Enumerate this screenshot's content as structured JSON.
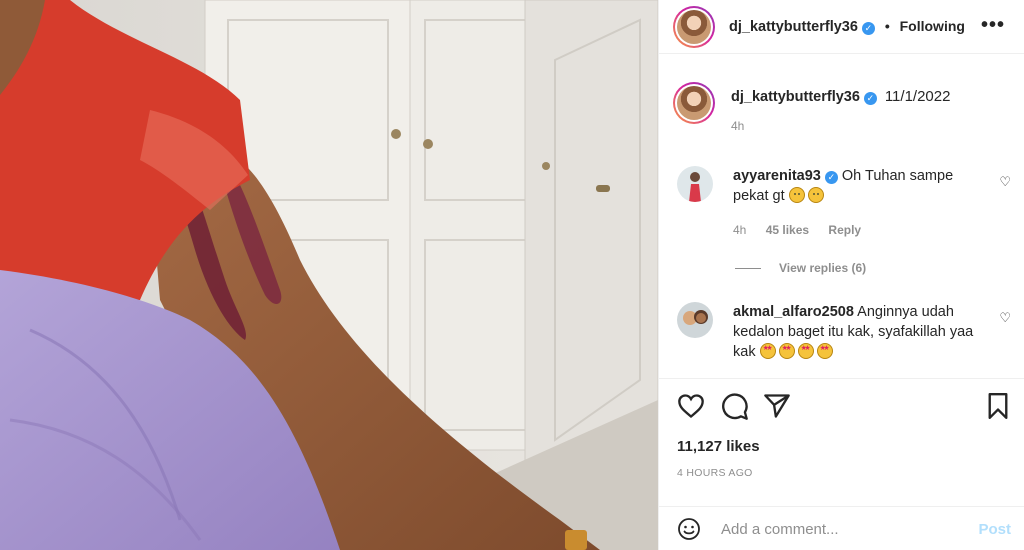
{
  "post": {
    "username": "dj_kattybutterfly36",
    "follow_separator": "•",
    "follow_label": "Following",
    "more_label": "•••"
  },
  "caption": {
    "username": "dj_kattybutterfly36",
    "text": "11/1/2022",
    "time": "4h"
  },
  "comments": [
    {
      "username": "ayyarenita93",
      "text": "Oh Tuhan sampe pekat gt",
      "emoji": [
        "sad-face",
        "sad-face"
      ],
      "time": "4h",
      "likes": "45 likes",
      "reply_label": "Reply",
      "view_replies": "View replies (6)"
    },
    {
      "username": "akmal_alfaro2508",
      "text": "Anginnya udah kedalon baget itu kak, syafakillah yaa kak",
      "emoji": [
        "star-struck-face",
        "star-struck-face",
        "star-struck-face",
        "star-struck-face"
      ]
    }
  ],
  "actions": {
    "icons": [
      "heart-icon",
      "comment-icon",
      "share-icon",
      "bookmark-icon"
    ]
  },
  "likes_text": "11,127 likes",
  "timestamp": "4 HOURS AGO",
  "add_comment": {
    "placeholder": "Add a comment...",
    "post_label": "Post"
  },
  "colors": {
    "verified": "#3897f0",
    "post_button_disabled": "#b2dffc",
    "secondary_text": "#8e8e8e"
  }
}
